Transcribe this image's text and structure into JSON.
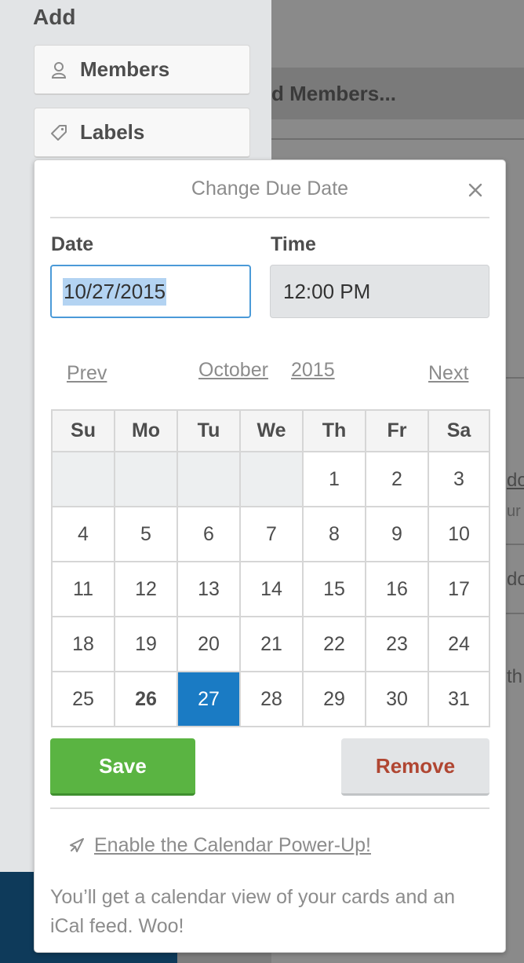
{
  "sidebar": {
    "heading": "Add",
    "members_label": "Members",
    "labels_label": "Labels"
  },
  "background": {
    "members_heading": "d Members...",
    "fragment_1": "do",
    "fragment_2": "ur",
    "fragment_3": "do",
    "fragment_4": "th"
  },
  "popover": {
    "title": "Change Due Date",
    "date_label": "Date",
    "time_label": "Time",
    "date_value": "10/27/2015",
    "time_value": "12:00 PM",
    "prev_label": "Prev",
    "next_label": "Next",
    "month": "October",
    "year": "2015",
    "weekdays": [
      "Su",
      "Mo",
      "Tu",
      "We",
      "Th",
      "Fr",
      "Sa"
    ],
    "weeks": [
      [
        "",
        "",
        "",
        "",
        "1",
        "2",
        "3"
      ],
      [
        "4",
        "5",
        "6",
        "7",
        "8",
        "9",
        "10"
      ],
      [
        "11",
        "12",
        "13",
        "14",
        "15",
        "16",
        "17"
      ],
      [
        "18",
        "19",
        "20",
        "21",
        "22",
        "23",
        "24"
      ],
      [
        "25",
        "26",
        "27",
        "28",
        "29",
        "30",
        "31"
      ]
    ],
    "today": "26",
    "selected": "27",
    "save_label": "Save",
    "remove_label": "Remove",
    "powerup_link": "Enable the Calendar Power-Up!",
    "description": "You’ll get a calendar view of your cards and an iCal feed. Woo!"
  },
  "colors": {
    "accent_blue": "#1a7bc4",
    "save_green": "#5ab442",
    "remove_red": "#b04632"
  }
}
